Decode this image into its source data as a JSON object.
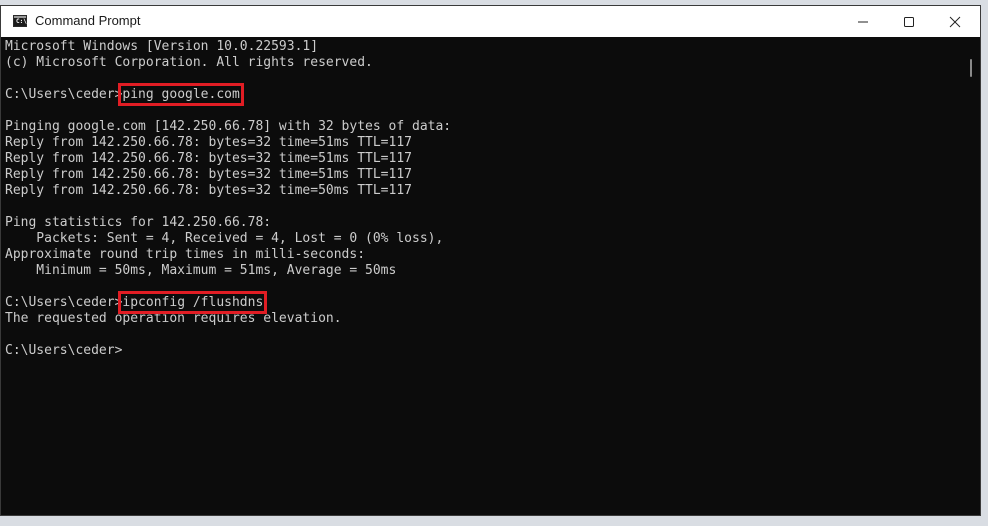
{
  "window": {
    "title": "Command Prompt",
    "icon": "C:\\",
    "highlight_color": "#e11d24"
  },
  "console": {
    "lines": [
      {
        "text": "Microsoft Windows [Version 10.0.22593.1]"
      },
      {
        "text": "(c) Microsoft Corporation. All rights reserved."
      },
      {
        "text": ""
      },
      {
        "prompt": "C:\\Users\\ceder>",
        "command": "ping google.com"
      },
      {
        "text": ""
      },
      {
        "text": "Pinging google.com [142.250.66.78] with 32 bytes of data:"
      },
      {
        "text": "Reply from 142.250.66.78: bytes=32 time=51ms TTL=117"
      },
      {
        "text": "Reply from 142.250.66.78: bytes=32 time=51ms TTL=117"
      },
      {
        "text": "Reply from 142.250.66.78: bytes=32 time=51ms TTL=117"
      },
      {
        "text": "Reply from 142.250.66.78: bytes=32 time=50ms TTL=117"
      },
      {
        "text": ""
      },
      {
        "text": "Ping statistics for 142.250.66.78:"
      },
      {
        "text": "    Packets: Sent = 4, Received = 4, Lost = 0 (0% loss),"
      },
      {
        "text": "Approximate round trip times in milli-seconds:"
      },
      {
        "text": "    Minimum = 50ms, Maximum = 51ms, Average = 50ms"
      },
      {
        "text": ""
      },
      {
        "prompt": "C:\\Users\\ceder>",
        "command": "ipconfig /flushdns"
      },
      {
        "text": "The requested operation requires elevation."
      },
      {
        "text": ""
      },
      {
        "prompt": "C:\\Users\\ceder>",
        "command": ""
      }
    ]
  }
}
